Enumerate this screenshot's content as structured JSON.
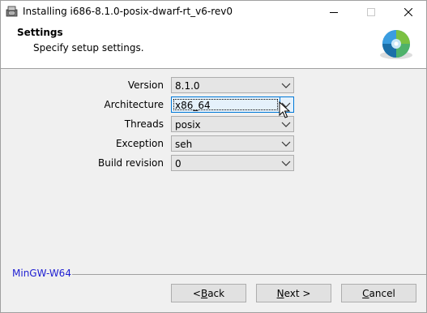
{
  "window": {
    "title": "Installing i686-8.1.0-posix-dwarf-rt_v6-rev0"
  },
  "header": {
    "title": "Settings",
    "subtitle": "Specify setup settings."
  },
  "form": {
    "version": {
      "label": "Version",
      "value": "8.1.0"
    },
    "architecture": {
      "label": "Architecture",
      "value": "x86_64"
    },
    "threads": {
      "label": "Threads",
      "value": "posix"
    },
    "exception": {
      "label": "Exception",
      "value": "seh"
    },
    "build_revision": {
      "label": "Build revision",
      "value": "0"
    }
  },
  "footer": {
    "brand": "MinGW-W64"
  },
  "buttons": {
    "back": {
      "prefix": "< ",
      "accel": "B",
      "rest": "ack"
    },
    "next": {
      "prefix": "",
      "accel": "N",
      "rest": "ext >"
    },
    "cancel": {
      "prefix": "",
      "accel": "C",
      "rest": "ancel"
    }
  },
  "colors": {
    "brand_text": "#1e1ed2",
    "focus_border": "#0078d7"
  }
}
